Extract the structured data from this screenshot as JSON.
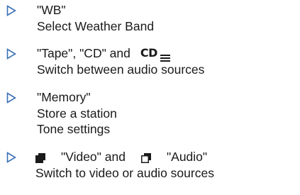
{
  "items": [
    {
      "lines": [
        "\"WB\"",
        "Select Weather Band"
      ]
    },
    {
      "lines": [
        "\"Tape\", \"CD\" and",
        "Switch between audio sources"
      ],
      "cd_icon_text": "CD"
    },
    {
      "lines": [
        "\"Memory\"",
        "Store a station",
        "Tone settings"
      ]
    },
    {
      "video_label": "\"Video\" and",
      "audio_label": "\"Audio\"",
      "lines": [
        "Switch to video or audio sources"
      ]
    }
  ],
  "colors": {
    "bullet": "#3a6fb5",
    "text": "#1a1a1a"
  },
  "icons": {
    "bullet": "triangle-right-outline-icon",
    "cd": "cd-icon",
    "menu": "menu-lines-icon",
    "video": "video-source-icon",
    "audio": "audio-source-icon"
  }
}
